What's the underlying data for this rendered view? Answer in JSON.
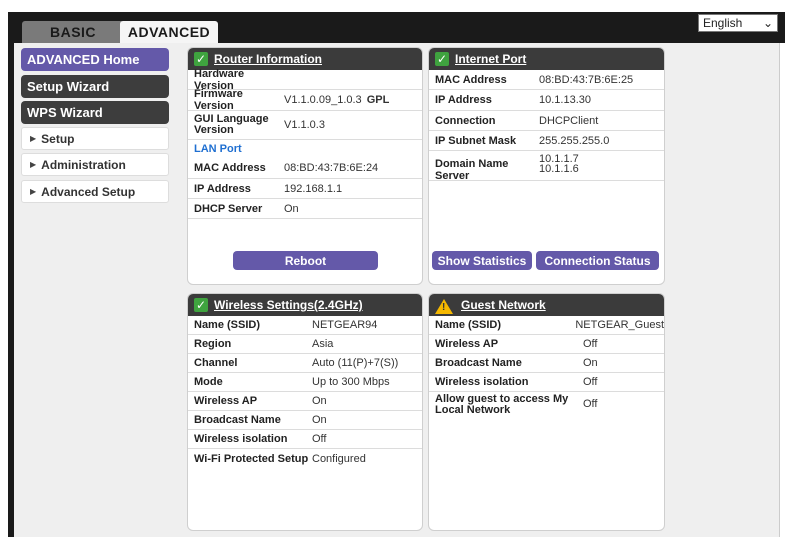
{
  "tabs": {
    "basic": "BASIC",
    "advanced": "ADVANCED"
  },
  "language": {
    "selected": "English"
  },
  "nav": {
    "home": "ADVANCED Home",
    "setup_wizard": "Setup Wizard",
    "wps_wizard": "WPS Wizard",
    "setup": "Setup",
    "administration": "Administration",
    "advanced_setup": "Advanced Setup"
  },
  "router_info": {
    "title": "Router Information",
    "hardware_version_label": "Hardware Version",
    "hardware_version": "",
    "firmware_version_label": "Firmware Version",
    "firmware_version": "V1.1.0.09_1.0.3",
    "firmware_gpl": "GPL",
    "gui_language_label": "GUI Language Version",
    "gui_language": "V1.1.0.3",
    "lan_port_label": "LAN Port",
    "mac_label": "MAC Address",
    "mac": "08:BD:43:7B:6E:24",
    "ip_label": "IP Address",
    "ip": "192.168.1.1",
    "dhcp_label": "DHCP Server",
    "dhcp": "On",
    "reboot": "Reboot"
  },
  "internet_port": {
    "title": "Internet Port",
    "mac_label": "MAC Address",
    "mac": "08:BD:43:7B:6E:25",
    "ip_label": "IP Address",
    "ip": "10.1.13.30",
    "connection_label": "Connection",
    "connection": "DHCPClient",
    "subnet_label": "IP Subnet Mask",
    "subnet": "255.255.255.0",
    "dns_label": "Domain Name Server",
    "dns1": "10.1.1.7",
    "dns2": "10.1.1.6",
    "show_statistics": "Show Statistics",
    "connection_status": "Connection Status"
  },
  "wireless": {
    "title": "Wireless Settings(2.4GHz)",
    "rows": [
      {
        "label": "Name (SSID)",
        "value": "NETGEAR94"
      },
      {
        "label": "Region",
        "value": "Asia"
      },
      {
        "label": "Channel",
        "value": "Auto (11(P)+7(S))"
      },
      {
        "label": "Mode",
        "value": "Up to 300 Mbps"
      },
      {
        "label": "Wireless AP",
        "value": "On"
      },
      {
        "label": "Broadcast Name",
        "value": "On"
      },
      {
        "label": "Wireless isolation",
        "value": "Off"
      },
      {
        "label": "Wi-Fi Protected Setup",
        "value": "Configured"
      }
    ]
  },
  "guest": {
    "title": "Guest Network",
    "rows": [
      {
        "label": "Name (SSID)",
        "value": "NETGEAR_Guest"
      },
      {
        "label": "Wireless AP",
        "value": "Off"
      },
      {
        "label": "Broadcast Name",
        "value": "On"
      },
      {
        "label": "Wireless isolation",
        "value": "Off"
      },
      {
        "label": "Allow guest to access My Local Network",
        "value": "Off"
      }
    ]
  },
  "colors": {
    "accent": "#6459a9",
    "header": "#3b3b3b",
    "ok": "#3fa33f",
    "warn": "#f5b800",
    "link": "#1f6fd1"
  }
}
